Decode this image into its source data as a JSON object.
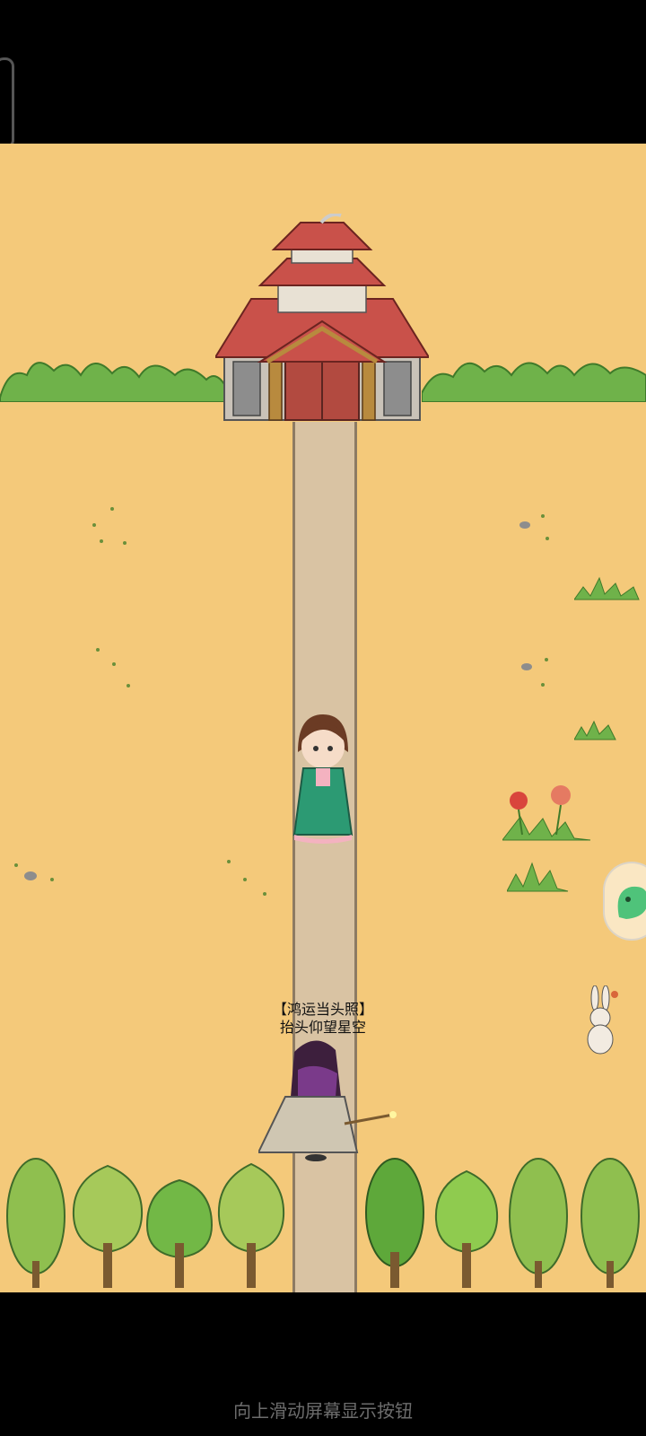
{
  "game": {
    "npc_title": "【鸿运当头照】",
    "npc_subtitle": "抬头仰望星空"
  },
  "system": {
    "swipe_hint": "向上滑动屏幕显示按钮"
  },
  "icons": {
    "side_button": "green-blob-icon",
    "temple": "temple-icon"
  },
  "colors": {
    "ground": "#f4c97a",
    "path": "#d9c3a3",
    "roof": "#c9514a",
    "foliage": "#6fb24a"
  }
}
